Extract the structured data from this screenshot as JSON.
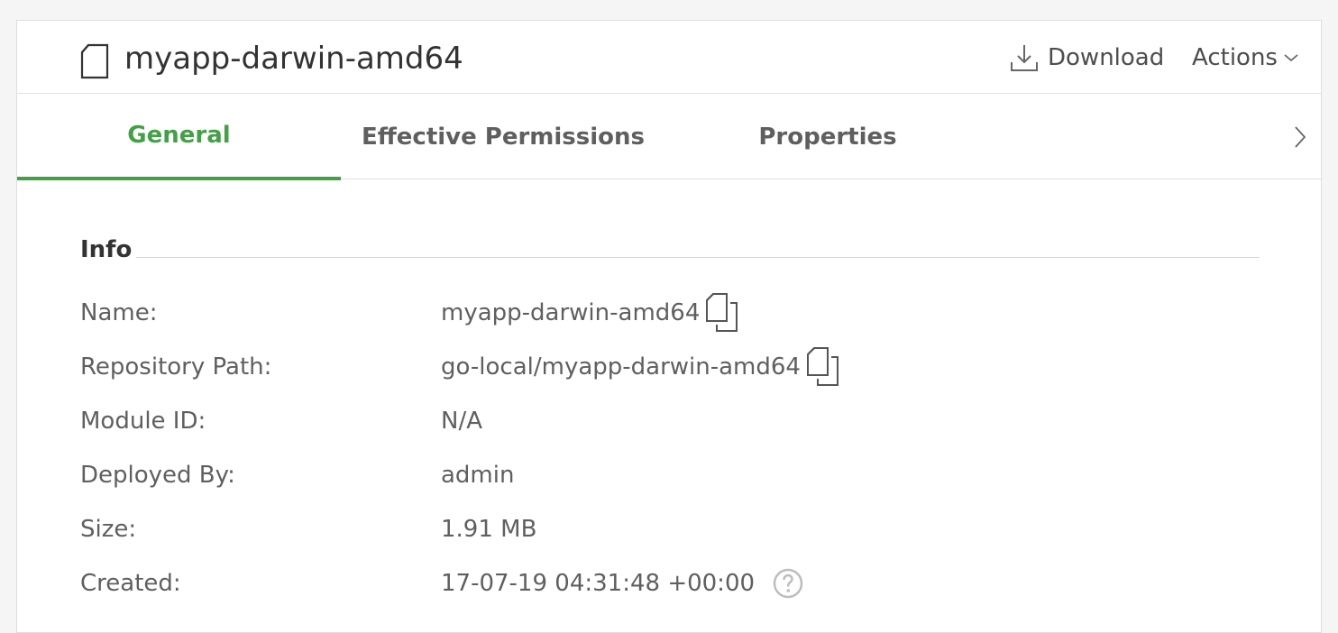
{
  "header": {
    "title": "myapp-darwin-amd64",
    "download_label": "Download",
    "actions_label": "Actions",
    "file_icon": "file-icon",
    "download_icon": "download-icon",
    "actions_icon": "chevron-down-icon"
  },
  "tabs": [
    {
      "label": "General",
      "active": true
    },
    {
      "label": "Effective Permissions",
      "active": false
    },
    {
      "label": "Properties",
      "active": false
    }
  ],
  "tabs_next_icon": "chevron-right-icon",
  "info": {
    "section_title": "Info",
    "rows": [
      {
        "key": "Name:",
        "value": "myapp-darwin-amd64",
        "icon": "copy-icon"
      },
      {
        "key": "Repository Path:",
        "value": "go-local/myapp-darwin-amd64",
        "icon": "copy-icon"
      },
      {
        "key": "Module ID:",
        "value": "N/A"
      },
      {
        "key": "Deployed By:",
        "value": "admin"
      },
      {
        "key": "Size:",
        "value": "1.91 MB"
      },
      {
        "key": "Created:",
        "value": "17-07-19 04:31:48 +00:00",
        "icon": "help-icon"
      }
    ]
  },
  "colors": {
    "accent": "#43a047",
    "text": "#5f5f5f",
    "title": "#333333"
  }
}
